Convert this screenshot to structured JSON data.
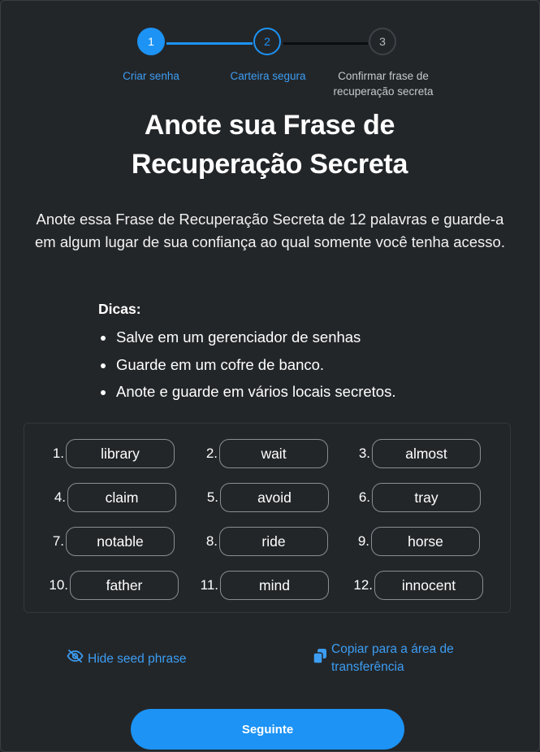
{
  "stepper": {
    "steps": [
      {
        "number": "1",
        "label": "Criar senha"
      },
      {
        "number": "2",
        "label": "Carteira segura"
      },
      {
        "number": "3",
        "label": "Confirmar frase de recuperação secreta"
      }
    ],
    "active_color": "#1c93f5"
  },
  "title": "Anote sua Frase de Recuperação Secreta",
  "intro": "Anote essa Frase de Recuperação Secreta de 12 palavras e guarde-a em algum lugar de sua confiança ao qual somente você tenha acesso.",
  "tips": {
    "title": "Dicas:",
    "items": [
      "Salve em um gerenciador de senhas",
      "Guarde em um cofre de banco.",
      "Anote e guarde em vários locais secretos."
    ]
  },
  "seed_words": [
    {
      "index": "1.",
      "word": "library"
    },
    {
      "index": "2.",
      "word": "wait"
    },
    {
      "index": "3.",
      "word": "almost"
    },
    {
      "index": "4.",
      "word": "claim"
    },
    {
      "index": "5.",
      "word": "avoid"
    },
    {
      "index": "6.",
      "word": "tray"
    },
    {
      "index": "7.",
      "word": "notable"
    },
    {
      "index": "8.",
      "word": "ride"
    },
    {
      "index": "9.",
      "word": "horse"
    },
    {
      "index": "10.",
      "word": "father"
    },
    {
      "index": "11.",
      "word": "mind"
    },
    {
      "index": "12.",
      "word": "innocent"
    }
  ],
  "actions": {
    "hide_label": "Hide seed phrase",
    "hide_icon": "eye-slash-icon",
    "copy_label": "Copiar para a área de transferência",
    "copy_icon": "copy-icon",
    "next_label": "Seguinte"
  }
}
